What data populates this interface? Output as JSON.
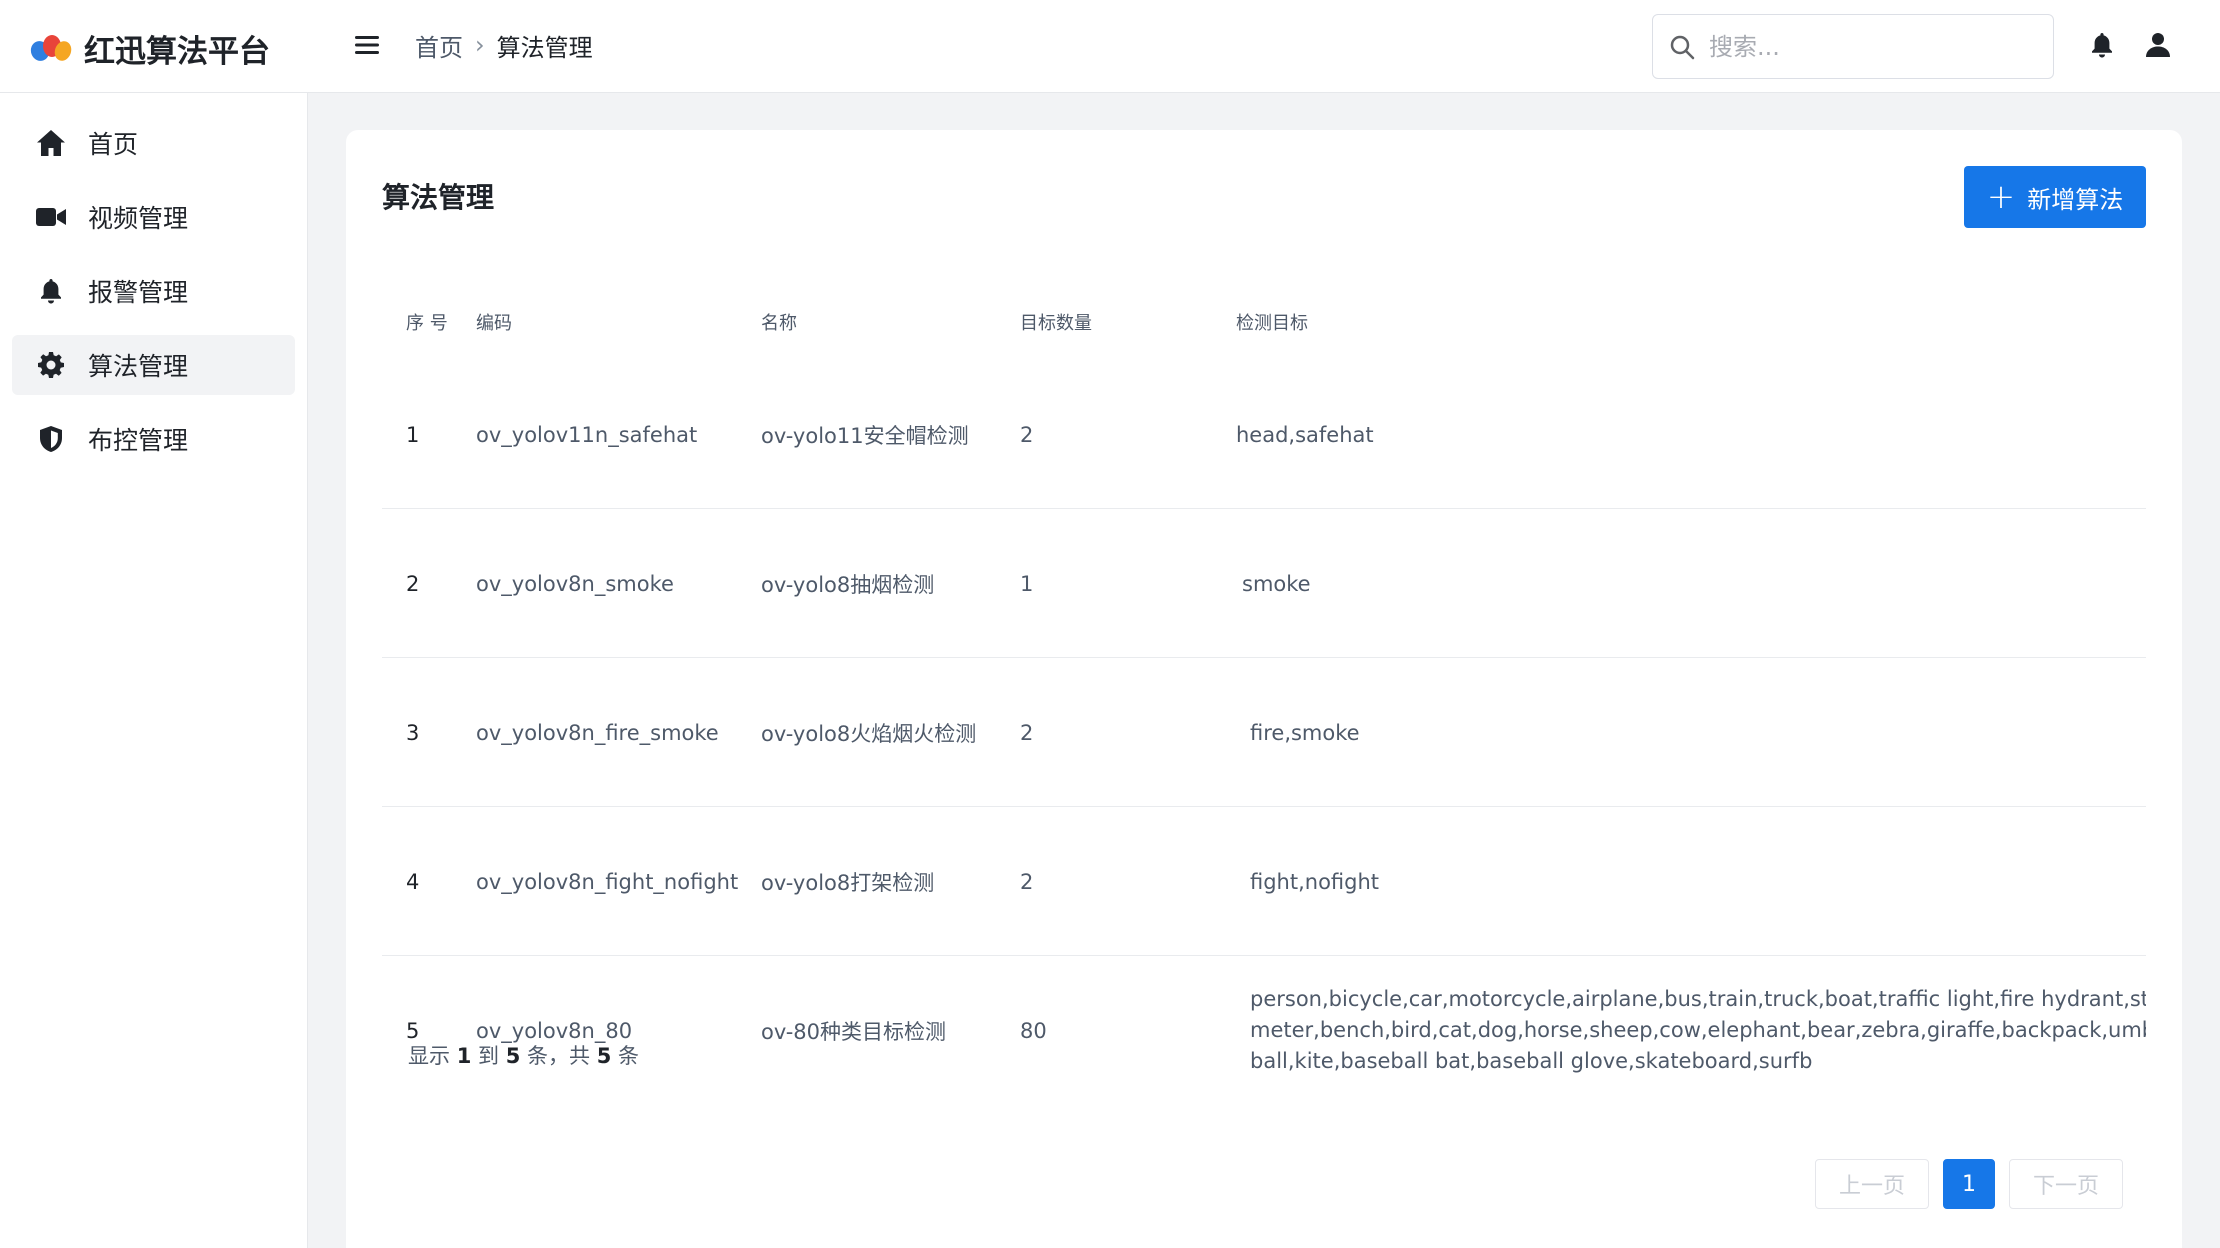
{
  "app": {
    "name": "红迅算法平台",
    "logo_colors": [
      "#f5a623",
      "#e8443a",
      "#2f7fe0"
    ]
  },
  "header": {
    "breadcrumb": [
      "首页",
      "算法管理"
    ],
    "breadcrumb_separator": "›",
    "search_placeholder": "搜索...",
    "icons": [
      "menu-icon",
      "search-icon",
      "bell-icon",
      "user-icon"
    ]
  },
  "sidebar": {
    "items": [
      {
        "label": "首页",
        "icon": "home-icon",
        "active": false
      },
      {
        "label": "视频管理",
        "icon": "video-camera-icon",
        "active": false
      },
      {
        "label": "报警管理",
        "icon": "bell-icon",
        "active": false
      },
      {
        "label": "算法管理",
        "icon": "gear-icon",
        "active": true
      },
      {
        "label": "布控管理",
        "icon": "shield-icon",
        "active": false
      }
    ]
  },
  "main": {
    "title": "算法管理",
    "add_button": {
      "plus": "+",
      "label": "新增算法"
    },
    "table": {
      "headers": [
        "序 号",
        "编码",
        "名称",
        "目标数量",
        "检测目标"
      ],
      "rows": [
        {
          "index": "1",
          "code": "ov_yolov11n_safehat",
          "name": "ov-yolo11安全帽检测",
          "count": "2",
          "targets": [
            "head,safehat"
          ]
        },
        {
          "index": "2",
          "code": "ov_yolov8n_smoke",
          "name": "ov-yolo8抽烟检测",
          "count": "1",
          "targets": [
            "smoke"
          ]
        },
        {
          "index": "3",
          "code": "ov_yolov8n_fire_smoke",
          "name": "ov-yolo8火焰烟火检测",
          "count": "2",
          "targets": [
            "fire,smoke"
          ]
        },
        {
          "index": "4",
          "code": "ov_yolov8n_fight_nofight",
          "name": "ov-yolo8打架检测",
          "count": "2",
          "targets": [
            "fight,nofight"
          ]
        },
        {
          "index": "5",
          "code": "ov_yolov8n_80",
          "name": "ov-80种类目标检测",
          "count": "80",
          "targets": [
            "person,bicycle,car,motorcycle,airplane,bus,train,truck,boat,traffic light,fire hydrant,stop sign,pa",
            "meter,bench,bird,cat,dog,horse,sheep,cow,elephant,bear,zebra,giraffe,backpack,umbrella,handl",
            "ball,kite,baseball bat,baseball glove,skateboard,surfb"
          ]
        }
      ]
    },
    "summary": {
      "prefix": "显示",
      "from": "1",
      "to_word": "到",
      "to": "5",
      "unit_word": "条，共",
      "total": "5",
      "suffix": "条"
    },
    "pagination": {
      "prev": "上一页",
      "current": "1",
      "next": "下一页"
    },
    "accent_color": "#1677e8"
  }
}
